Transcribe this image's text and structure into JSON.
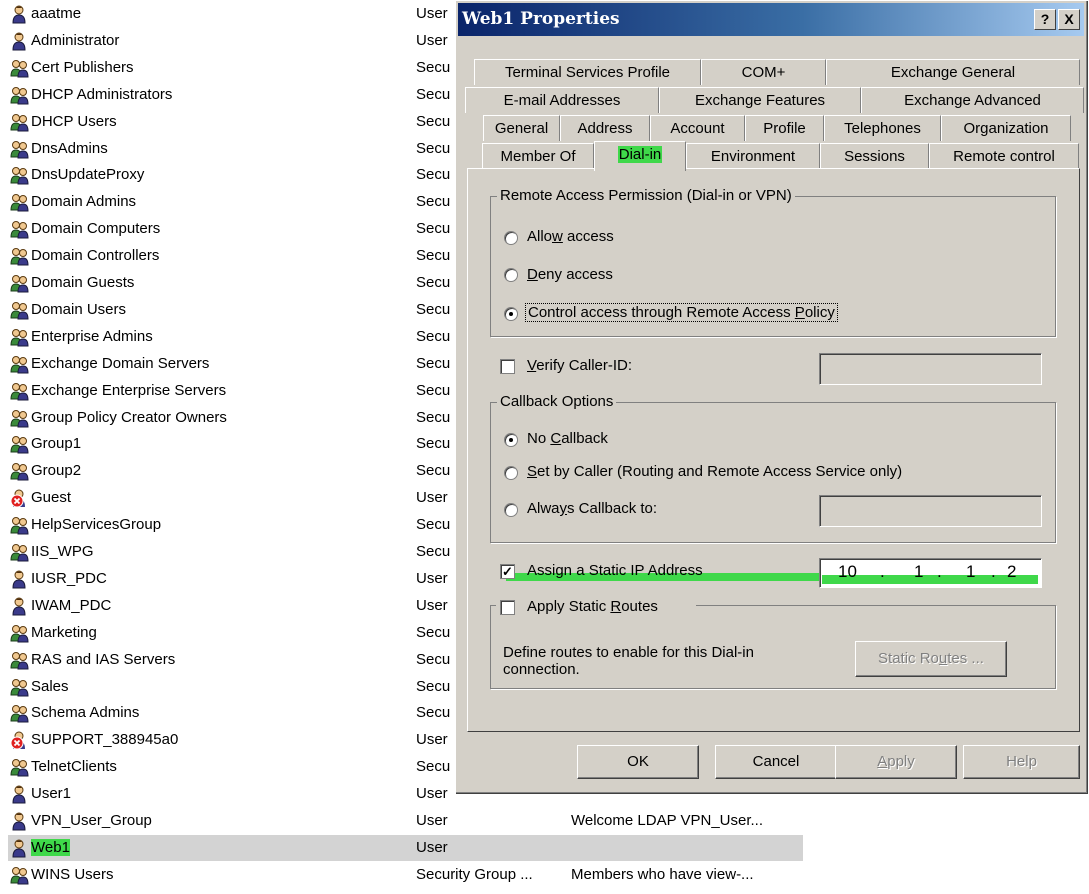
{
  "list": {
    "rows": [
      {
        "name": "aaatme",
        "type": "User",
        "desc": "",
        "icon": "user-icon"
      },
      {
        "name": "Administrator",
        "type": "User",
        "desc": "",
        "icon": "user-icon"
      },
      {
        "name": "Cert Publishers",
        "type": "Secu",
        "desc": "",
        "icon": "group-icon"
      },
      {
        "name": "DHCP Administrators",
        "type": "Secu",
        "desc": "",
        "icon": "group-icon"
      },
      {
        "name": "DHCP Users",
        "type": "Secu",
        "desc": "",
        "icon": "group-icon"
      },
      {
        "name": "DnsAdmins",
        "type": "Secu",
        "desc": "",
        "icon": "group-icon"
      },
      {
        "name": "DnsUpdateProxy",
        "type": "Secu",
        "desc": "",
        "icon": "group-icon"
      },
      {
        "name": "Domain Admins",
        "type": "Secu",
        "desc": "",
        "icon": "group-icon"
      },
      {
        "name": "Domain Computers",
        "type": "Secu",
        "desc": "",
        "icon": "group-icon"
      },
      {
        "name": "Domain Controllers",
        "type": "Secu",
        "desc": "",
        "icon": "group-icon"
      },
      {
        "name": "Domain Guests",
        "type": "Secu",
        "desc": "",
        "icon": "group-icon"
      },
      {
        "name": "Domain Users",
        "type": "Secu",
        "desc": "",
        "icon": "group-icon"
      },
      {
        "name": "Enterprise Admins",
        "type": "Secu",
        "desc": "",
        "icon": "group-icon"
      },
      {
        "name": "Exchange Domain Servers",
        "type": "Secu",
        "desc": "",
        "icon": "group-icon"
      },
      {
        "name": "Exchange Enterprise Servers",
        "type": "Secu",
        "desc": "",
        "icon": "group-icon"
      },
      {
        "name": "Group Policy Creator Owners",
        "type": "Secu",
        "desc": "",
        "icon": "group-icon"
      },
      {
        "name": "Group1",
        "type": "Secu",
        "desc": "",
        "icon": "group-icon"
      },
      {
        "name": "Group2",
        "type": "Secu",
        "desc": "",
        "icon": "group-icon"
      },
      {
        "name": "Guest",
        "type": "User",
        "desc": "",
        "icon": "disabled-user-icon"
      },
      {
        "name": "HelpServicesGroup",
        "type": "Secu",
        "desc": "",
        "icon": "group-icon"
      },
      {
        "name": "IIS_WPG",
        "type": "Secu",
        "desc": "",
        "icon": "group-icon"
      },
      {
        "name": "IUSR_PDC",
        "type": "User",
        "desc": "",
        "icon": "user-icon"
      },
      {
        "name": "IWAM_PDC",
        "type": "User",
        "desc": "",
        "icon": "user-icon"
      },
      {
        "name": "Marketing",
        "type": "Secu",
        "desc": "",
        "icon": "group-icon"
      },
      {
        "name": "RAS and IAS Servers",
        "type": "Secu",
        "desc": "",
        "icon": "group-icon"
      },
      {
        "name": "Sales",
        "type": "Secu",
        "desc": "",
        "icon": "group-icon"
      },
      {
        "name": "Schema Admins",
        "type": "Secu",
        "desc": "",
        "icon": "group-icon"
      },
      {
        "name": "SUPPORT_388945a0",
        "type": "User",
        "desc": "",
        "icon": "disabled-user-icon"
      },
      {
        "name": "TelnetClients",
        "type": "Secu",
        "desc": "",
        "icon": "group-icon"
      },
      {
        "name": "User1",
        "type": "User",
        "desc": "",
        "icon": "user-icon"
      },
      {
        "name": "VPN_User_Group",
        "type": "User",
        "desc": "Welcome LDAP VPN_User...",
        "icon": "user-icon"
      },
      {
        "name": "Web1",
        "type": "User",
        "desc": "",
        "icon": "user-icon",
        "selected": true
      },
      {
        "name": "WINS Users",
        "type": "Security Group ...",
        "desc": "Members who have view-...",
        "icon": "group-icon"
      }
    ]
  },
  "dialog": {
    "title": "Web1 Properties",
    "help_btn": "?",
    "close_btn": "X",
    "tabs_row1": [
      "Terminal Services Profile",
      "COM+",
      "Exchange General"
    ],
    "tabs_row2": [
      "E-mail Addresses",
      "Exchange Features",
      "Exchange Advanced"
    ],
    "tabs_row3": [
      "General",
      "Address",
      "Account",
      "Profile",
      "Telephones",
      "Organization"
    ],
    "tabs_row4": [
      "Member Of",
      "Dial-in",
      "Environment",
      "Sessions",
      "Remote control"
    ],
    "active_tab": "Dial-in",
    "remote_access": {
      "legend": "Remote Access Permission (Dial-in or VPN)",
      "allow_a": "Allo",
      "allow_u": "w",
      "allow_b": " access",
      "deny_u": "D",
      "deny_b": "eny access",
      "control_a": "Control access through Remote Access ",
      "control_u": "P",
      "control_b": "olicy",
      "selected": "control"
    },
    "verify_a": "",
    "verify_u": "V",
    "verify_b": "erify Caller-ID:",
    "verify_value": "",
    "callback": {
      "legend": "Callback Options",
      "no_a": "No ",
      "no_u": "C",
      "no_b": "allback",
      "set_u": "S",
      "set_b": "et by Caller (Routing and Remote Access Service only)",
      "always_a": "Alwa",
      "always_u": "y",
      "always_b": "s Callback to:",
      "always_value": "",
      "selected": "no"
    },
    "static_ip": {
      "label": "Assign a Static IP Address",
      "checked": true,
      "o1": "10",
      "o2": "1",
      "o3": "1",
      "o4": "2",
      "dot": "."
    },
    "routes": {
      "label_a": "Apply Static ",
      "label_u": "R",
      "label_b": "outes",
      "checked": false,
      "desc_line1": "Define routes to enable for this Dial-in",
      "desc_line2": "connection.",
      "button_a": "Static Ro",
      "button_u": "u",
      "button_b": "tes ..."
    },
    "buttons": {
      "ok": "OK",
      "cancel": "Cancel",
      "apply_u": "A",
      "apply_b": "pply",
      "help": "Help"
    }
  },
  "colors": {
    "highlight": "#3fd84a",
    "titlebar": "#0a246a",
    "face": "#d4d0c8"
  }
}
